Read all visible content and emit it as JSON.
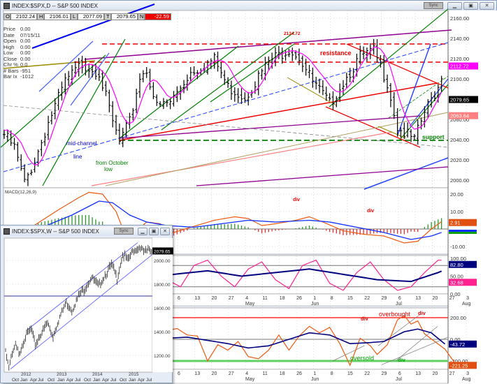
{
  "main_window": {
    "title": "INDEX:$SPX,D -- S&P 500 INDEX",
    "sync_label": "Sync",
    "ohlc": [
      {
        "key": "O",
        "value": "2102.24"
      },
      {
        "key": "H",
        "value": "2106.01"
      },
      {
        "key": "L",
        "value": "2077.09"
      },
      {
        "key": "T",
        "value": "2079.65"
      },
      {
        "key": "N",
        "value": "-22.59"
      }
    ],
    "info": [
      {
        "k": "Price",
        "v": "0.00"
      },
      {
        "k": "Date",
        "v": "07/15/11"
      },
      {
        "k": "Open",
        "v": "0.00"
      },
      {
        "k": "High",
        "v": "0.00"
      },
      {
        "k": "Low",
        "v": "0.00"
      },
      {
        "k": "Close",
        "v": "0.00"
      },
      {
        "k": "Chr %",
        "v": "0.0"
      },
      {
        "k": "# Bars",
        "v": "-951"
      },
      {
        "k": "Bar Ix",
        "v": "-1012"
      }
    ],
    "window_buttons": [
      "minimize",
      "restore",
      "close"
    ]
  },
  "colors": {
    "down": "#e00000",
    "magenta": "#ff00ff",
    "navy": "#00007f",
    "pink": "#ff2090",
    "orange": "#ee5a10",
    "green": "#008000"
  },
  "chart_data": [
    {
      "type": "line",
      "title": "S&P 500 daily",
      "panel": "price",
      "ylim": [
        1995,
        2165
      ],
      "yticks": [
        "2160.00",
        "2140.00",
        "2120.00",
        "2100.00",
        "2060.00",
        "2040.00",
        "2020.00",
        "2000.00"
      ],
      "last_labels": {
        "ma": "2112.72",
        "close": "2079.65",
        "channel": "2063.64"
      },
      "path_days_price": [
        [
          0,
          2048
        ],
        [
          3,
          2035
        ],
        [
          6,
          2000
        ],
        [
          9,
          2022
        ],
        [
          13,
          2060
        ],
        [
          18,
          2100
        ],
        [
          23,
          2118
        ],
        [
          28,
          2110
        ],
        [
          32,
          2060
        ],
        [
          34,
          2040
        ],
        [
          37,
          2060
        ],
        [
          40,
          2105
        ],
        [
          42,
          2112
        ],
        [
          45,
          2075
        ],
        [
          49,
          2080
        ],
        [
          55,
          2110
        ],
        [
          62,
          2122
        ],
        [
          66,
          2095
        ],
        [
          71,
          2085
        ],
        [
          78,
          2120
        ],
        [
          84,
          2133
        ],
        [
          87,
          2125
        ],
        [
          91,
          2100
        ],
        [
          96,
          2078
        ],
        [
          99,
          2095
        ],
        [
          105,
          2125
        ],
        [
          109,
          2130
        ],
        [
          113,
          2100
        ],
        [
          116,
          2055
        ],
        [
          121,
          2042
        ],
        [
          124,
          2070
        ],
        [
          128,
          2095
        ],
        [
          131,
          2132
        ],
        [
          133,
          2118
        ],
        [
          135,
          2100
        ],
        [
          137,
          2098
        ],
        [
          139,
          2080
        ]
      ],
      "annotations": {
        "high": "2134.72",
        "resistance": "resistance",
        "mid1": "mid-channel",
        "mid2": "line",
        "oct1": "from October",
        "oct2": "low",
        "support": "support"
      }
    },
    {
      "type": "line",
      "title": "MACD(12,26,9)",
      "panel": "macd",
      "ylim": [
        -14,
        22
      ],
      "yticks": [
        "20.00",
        "10.00",
        "-10.00"
      ],
      "macd": [
        [
          0,
          -1
        ],
        [
          8,
          1
        ],
        [
          16,
          11
        ],
        [
          22,
          18
        ],
        [
          25,
          21
        ],
        [
          29,
          20
        ],
        [
          33,
          10
        ],
        [
          35,
          0
        ],
        [
          38,
          -3
        ],
        [
          42,
          4
        ],
        [
          46,
          3
        ],
        [
          50,
          -2
        ],
        [
          55,
          1
        ],
        [
          62,
          5
        ],
        [
          68,
          7
        ],
        [
          72,
          6
        ],
        [
          76,
          2
        ],
        [
          80,
          3
        ],
        [
          86,
          5
        ],
        [
          90,
          7
        ],
        [
          94,
          4
        ],
        [
          100,
          -1
        ],
        [
          106,
          -3
        ],
        [
          112,
          -4
        ],
        [
          118,
          -8
        ],
        [
          122,
          -7
        ],
        [
          126,
          0
        ],
        [
          131,
          7
        ],
        [
          134,
          8
        ],
        [
          137,
          5
        ],
        [
          139,
          2.91
        ]
      ],
      "signal": [
        [
          0,
          -2
        ],
        [
          10,
          0
        ],
        [
          20,
          8
        ],
        [
          28,
          16
        ],
        [
          32,
          15
        ],
        [
          37,
          8
        ],
        [
          42,
          4
        ],
        [
          48,
          2
        ],
        [
          56,
          1
        ],
        [
          64,
          3
        ],
        [
          72,
          5
        ],
        [
          80,
          4
        ],
        [
          90,
          5
        ],
        [
          96,
          4
        ],
        [
          104,
          1
        ],
        [
          112,
          -2
        ],
        [
          120,
          -6
        ],
        [
          126,
          -4
        ],
        [
          132,
          0
        ],
        [
          137,
          2
        ],
        [
          139,
          2
        ]
      ],
      "labels": {
        "last_macd": "2.91",
        "div1": "div",
        "div2": "div"
      }
    },
    {
      "type": "line",
      "title": "Stochastic",
      "panel": "stoch",
      "ylim": [
        0,
        100
      ],
      "yticks": [
        "100.00",
        "50.00",
        "0.00"
      ],
      "fast": [
        [
          0,
          60
        ],
        [
          4,
          20
        ],
        [
          8,
          80
        ],
        [
          12,
          95
        ],
        [
          16,
          60
        ],
        [
          20,
          20
        ],
        [
          24,
          70
        ],
        [
          28,
          90
        ],
        [
          32,
          30
        ],
        [
          36,
          10
        ],
        [
          40,
          70
        ],
        [
          44,
          95
        ],
        [
          48,
          40
        ],
        [
          52,
          20
        ],
        [
          56,
          80
        ],
        [
          60,
          95
        ],
        [
          64,
          50
        ],
        [
          68,
          20
        ],
        [
          72,
          70
        ],
        [
          76,
          90
        ],
        [
          80,
          40
        ],
        [
          84,
          15
        ],
        [
          88,
          80
        ],
        [
          92,
          95
        ],
        [
          96,
          30
        ],
        [
          100,
          10
        ],
        [
          104,
          60
        ],
        [
          108,
          90
        ],
        [
          112,
          40
        ],
        [
          116,
          10
        ],
        [
          120,
          20
        ],
        [
          124,
          60
        ],
        [
          128,
          95
        ],
        [
          132,
          95
        ],
        [
          136,
          60
        ],
        [
          139,
          32.68
        ]
      ],
      "slow": [
        [
          0,
          50
        ],
        [
          10,
          60
        ],
        [
          20,
          55
        ],
        [
          30,
          60
        ],
        [
          40,
          45
        ],
        [
          50,
          55
        ],
        [
          60,
          65
        ],
        [
          70,
          50
        ],
        [
          80,
          60
        ],
        [
          90,
          70
        ],
        [
          100,
          55
        ],
        [
          110,
          40
        ],
        [
          120,
          35
        ],
        [
          128,
          60
        ],
        [
          134,
          85
        ],
        [
          137,
          87
        ],
        [
          139,
          82.8
        ]
      ],
      "labels": {
        "slow": "82.80",
        "fast": "32.68"
      }
    },
    {
      "type": "line",
      "title": "CCI",
      "panel": "cci",
      "ylim": [
        -260,
        250
      ],
      "yticks": [
        "200.00",
        "0.00",
        "-200.00"
      ],
      "cci": [
        [
          0,
          50
        ],
        [
          3,
          120
        ],
        [
          6,
          60
        ],
        [
          9,
          60
        ],
        [
          12,
          0
        ],
        [
          15,
          50
        ],
        [
          18,
          -100
        ],
        [
          21,
          -40
        ],
        [
          24,
          10
        ],
        [
          27,
          50
        ],
        [
          30,
          -150
        ],
        [
          33,
          -100
        ],
        [
          36,
          -190
        ],
        [
          39,
          -50
        ],
        [
          42,
          70
        ],
        [
          45,
          -20
        ],
        [
          48,
          80
        ],
        [
          51,
          100
        ],
        [
          54,
          40
        ],
        [
          57,
          30
        ],
        [
          60,
          -200
        ],
        [
          63,
          -50
        ],
        [
          66,
          -100
        ],
        [
          69,
          -20
        ],
        [
          72,
          -160
        ],
        [
          75,
          -180
        ],
        [
          78,
          -100
        ],
        [
          81,
          40
        ],
        [
          84,
          -100
        ],
        [
          87,
          30
        ],
        [
          90,
          120
        ],
        [
          93,
          60
        ],
        [
          96,
          110
        ],
        [
          99,
          -40
        ],
        [
          102,
          -240
        ],
        [
          105,
          10
        ],
        [
          108,
          -60
        ],
        [
          110,
          -140
        ],
        [
          113,
          -50
        ],
        [
          116,
          180
        ],
        [
          118,
          220
        ],
        [
          120,
          140
        ],
        [
          122,
          170
        ],
        [
          124,
          50
        ],
        [
          127,
          -20
        ],
        [
          130,
          -90
        ],
        [
          133,
          -221.25
        ]
      ],
      "avg": [
        [
          0,
          30
        ],
        [
          6,
          50
        ],
        [
          12,
          40
        ],
        [
          18,
          20
        ],
        [
          24,
          0
        ],
        [
          30,
          -40
        ],
        [
          36,
          -80
        ],
        [
          42,
          -50
        ],
        [
          48,
          10
        ],
        [
          54,
          20
        ],
        [
          60,
          -10
        ],
        [
          66,
          -40
        ],
        [
          72,
          -80
        ],
        [
          78,
          -60
        ],
        [
          84,
          0
        ],
        [
          90,
          60
        ],
        [
          96,
          40
        ],
        [
          102,
          -40
        ],
        [
          108,
          -30
        ],
        [
          112,
          -20
        ],
        [
          118,
          70
        ],
        [
          122,
          95
        ],
        [
          126,
          60
        ],
        [
          130,
          -43.72
        ]
      ],
      "labels": {
        "avg": "-43.72",
        "cci": "-221.25",
        "overbought": "overbought",
        "oversold": "oversold",
        "div1": "div",
        "div2": "div",
        "div3": "div"
      }
    },
    {
      "type": "line",
      "title": "INDEX:$SPX,W -- S&P 500 INDEX",
      "panel": "weekly",
      "ylim": [
        1050,
        2150
      ],
      "yticks": [
        "2000.00",
        "1800.00",
        "1600.00",
        "1400.00",
        "1200.00"
      ],
      "last": "2079.65",
      "hline": 1700,
      "path_week_price": [
        [
          0,
          1250
        ],
        [
          3,
          1100
        ],
        [
          6,
          1200
        ],
        [
          9,
          1280
        ],
        [
          12,
          1220
        ],
        [
          18,
          1360
        ],
        [
          23,
          1420
        ],
        [
          27,
          1290
        ],
        [
          33,
          1400
        ],
        [
          38,
          1470
        ],
        [
          43,
          1360
        ],
        [
          48,
          1500
        ],
        [
          55,
          1650
        ],
        [
          60,
          1580
        ],
        [
          66,
          1700
        ],
        [
          72,
          1770
        ],
        [
          78,
          1860
        ],
        [
          84,
          1780
        ],
        [
          90,
          1880
        ],
        [
          96,
          1960
        ],
        [
          101,
          1850
        ],
        [
          106,
          2050
        ],
        [
          111,
          2000
        ],
        [
          116,
          2090
        ],
        [
          122,
          2110
        ],
        [
          126,
          2060
        ],
        [
          130,
          2100
        ],
        [
          132,
          2079.65
        ]
      ],
      "xlabels": [
        "Oct",
        "Jan",
        "Apr",
        "Jul",
        "Oct",
        "Jan",
        "Apr",
        "Jul",
        "Oct",
        "Jan",
        "Apr",
        "Jul",
        "Oct",
        "Jan",
        "Apr",
        "Jul"
      ],
      "years": [
        "2012",
        "2013",
        "2014",
        "2015"
      ]
    }
  ],
  "date_axis": {
    "days": [
      "6",
      "13",
      "20",
      "27",
      "4",
      "11",
      "18",
      "26",
      "1",
      "8",
      "15",
      "22",
      "29",
      "6",
      "13",
      "20",
      "27",
      "3"
    ],
    "months": {
      "apr": "pr",
      "may": "May",
      "jun": "Jun",
      "jul": "Jul",
      "aug": "Aug"
    }
  }
}
